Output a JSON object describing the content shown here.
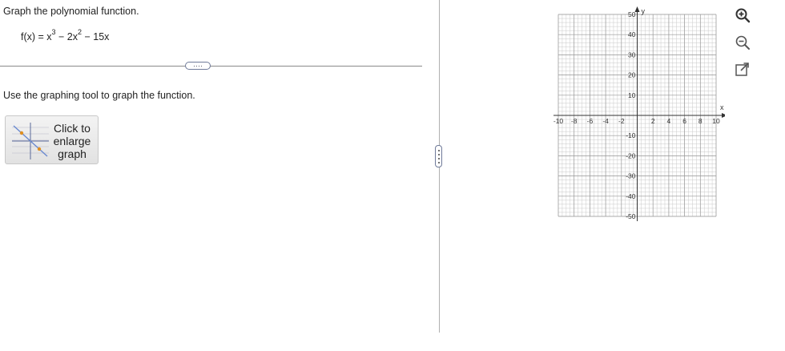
{
  "question": {
    "instruction": "Graph the polynomial function.",
    "function_prefix": "f(x) = x",
    "exp1": "3",
    "term2": " − 2x",
    "exp2": "2",
    "term3": " − 15x",
    "more_button": "····",
    "tool_instruction": "Use the graphing tool to graph the function."
  },
  "enlarge_button": {
    "line1": "Click to",
    "line2": "enlarge",
    "line3": "graph"
  },
  "graph": {
    "x_axis_label": "x",
    "y_axis_label": "y",
    "x_ticks": [
      "-10",
      "-8",
      "-6",
      "-4",
      "-2",
      "2",
      "4",
      "6",
      "8",
      "10"
    ],
    "y_ticks": [
      "50",
      "40",
      "30",
      "20",
      "10",
      "-10",
      "-20",
      "-30",
      "-40",
      "-50"
    ],
    "xlim": [
      -10,
      10
    ],
    "ylim": [
      -50,
      50
    ],
    "grid": true
  },
  "tools": {
    "zoom_in_icon": "zoom-in-icon",
    "zoom_out_icon": "zoom-out-icon",
    "expand_icon": "expand-icon"
  }
}
